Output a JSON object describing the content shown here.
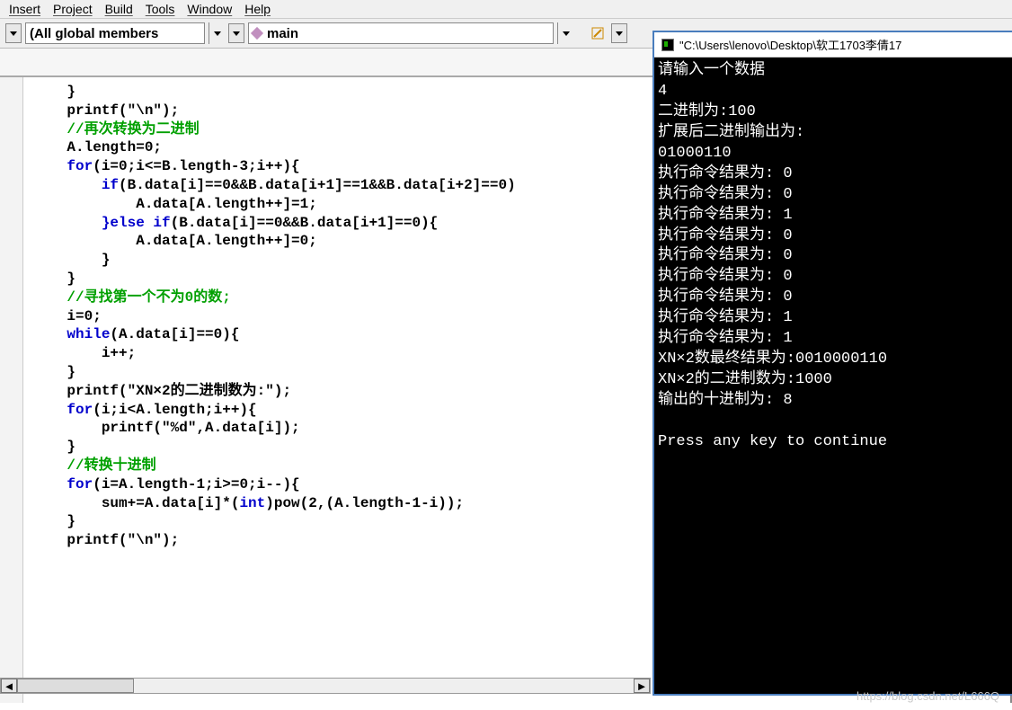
{
  "menu": {
    "items": [
      "Insert",
      "Project",
      "Build",
      "Tools",
      "Window",
      "Help"
    ]
  },
  "toolbar": {
    "dropdown1_label": "(All global members",
    "dropdown2_label": "main"
  },
  "code": {
    "line01": "}",
    "line02a": "printf(",
    "line02b": "\"\\n\"",
    "line02c": ");",
    "line03": "//再次转换为二进制",
    "line04": "A.length=0;",
    "line05a": "for",
    "line05b": "(i=0;i<=B.length-3;i++){",
    "line06a": "    if",
    "line06b": "(B.data[i]==0&&B.data[i+1]==1&&B.data[i+2]==0)",
    "line07": "        A.data[A.length++]=1;",
    "line08a": "    }else if",
    "line08b": "(B.data[i]==0&&B.data[i+1]==0){",
    "line09": "        A.data[A.length++]=0;",
    "line10": "    }",
    "line11": "}",
    "line12": "//寻找第一个不为0的数;",
    "line13": "i=0;",
    "line14a": "while",
    "line14b": "(A.data[i]==0){",
    "line15": "    i++;",
    "line16": "}",
    "line17a": "printf(",
    "line17b": "\"XN×2的二进制数为:\"",
    "line17c": ");",
    "line18a": "for",
    "line18b": "(i;i<A.length;i++){",
    "line19a": "    printf(",
    "line19b": "\"%d\"",
    "line19c": ",A.data[i]);",
    "line20": "}",
    "line21": "//转换十进制",
    "line22a": "for",
    "line22b": "(i=A.length-1;i>=0;i--){",
    "line23a": "    sum+=A.data[i]*(",
    "line23b": "int",
    "line23c": ")pow(2,(A.length-1-i));",
    "line24": "}",
    "line25a": "printf(",
    "line25b": "\"\\n\"",
    "line25c": ");"
  },
  "console": {
    "title": "\"C:\\Users\\lenovo\\Desktop\\软工1703李倩17",
    "lines": [
      "请输入一个数据",
      "4",
      "二进制为:100",
      "扩展后二进制输出为:",
      "01000110",
      "执行命令结果为: 0",
      "执行命令结果为: 0",
      "执行命令结果为: 1",
      "执行命令结果为: 0",
      "执行命令结果为: 0",
      "执行命令结果为: 0",
      "执行命令结果为: 0",
      "执行命令结果为: 1",
      "执行命令结果为: 1",
      "XN×2数最终结果为:0010000110",
      "XN×2的二进制数为:1000",
      "输出的十进制为: 8",
      "",
      "Press any key to continue"
    ]
  },
  "watermark": "https://blog.csdn.net/L666Q"
}
